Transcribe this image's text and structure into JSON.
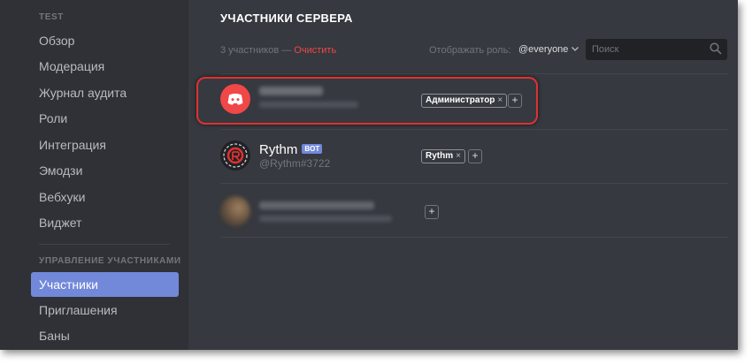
{
  "sidebar": {
    "server_header": "TEST",
    "server_items": [
      {
        "label": "Обзор"
      },
      {
        "label": "Модерация"
      },
      {
        "label": "Журнал аудита"
      },
      {
        "label": "Роли"
      },
      {
        "label": "Интеграция"
      },
      {
        "label": "Эмодзи"
      },
      {
        "label": "Вебхуки"
      },
      {
        "label": "Виджет"
      }
    ],
    "members_header": "УПРАВЛЕНИЕ УЧАСТНИКАМИ",
    "member_items": [
      {
        "label": "Участники",
        "active": true
      },
      {
        "label": "Приглашения"
      },
      {
        "label": "Баны"
      }
    ]
  },
  "main": {
    "title": "УЧАСТНИКИ СЕРВЕРА",
    "count_text": "3 участников —",
    "clear_label": "Очистить",
    "roles_label": "Отображать роль:",
    "roles_value": "@everyone",
    "search_placeholder": "Поиск",
    "members": [
      {
        "name": "",
        "tag": "",
        "roles": [
          {
            "label": "Администратор"
          }
        ],
        "add_label": "+",
        "highlighted": true
      },
      {
        "name": "Rythm",
        "badge": "BOT",
        "tag": "@Rythm#3722",
        "roles": [
          {
            "label": "Rythm"
          }
        ],
        "add_label": "+"
      },
      {
        "name": "",
        "tag": "",
        "roles": [],
        "add_label": "+"
      }
    ]
  },
  "colors": {
    "background": "#36393f",
    "sidebar": "#2f3136",
    "accent": "#7289da",
    "danger": "#f04747",
    "highlight": "#e03131"
  }
}
